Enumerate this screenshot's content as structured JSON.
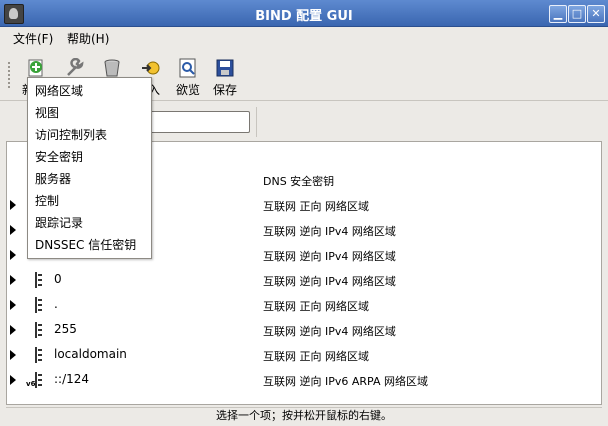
{
  "window": {
    "title": "BIND 配置 GUI",
    "min": "▁",
    "max": "□",
    "close": "✕"
  },
  "menu": {
    "file": "文件(F)",
    "help": "帮助(H)"
  },
  "toolbar": {
    "new_label": "新",
    "import_label": "入",
    "preview_label": "欲览",
    "save_label": "保存",
    "icons": [
      "add-icon",
      "wrench-icon",
      "trash-icon",
      "import-icon",
      "preview-icon",
      "save-icon"
    ]
  },
  "search": {
    "value": ""
  },
  "tree": {
    "rows": [
      {
        "name": "",
        "type": "DNS 安全密钥",
        "icon": false,
        "expander": false
      },
      {
        "name": "",
        "type": "互联网 正向 网络区域",
        "icon": false,
        "expander": true
      },
      {
        "name": "",
        "type": "互联网 逆向 IPv4 网络区域",
        "icon": false,
        "expander": true
      },
      {
        "name": "",
        "type": "互联网 逆向 IPv4 网络区域",
        "icon": false,
        "expander": true
      },
      {
        "name": "0",
        "type": "互联网 逆向 IPv4 网络区域",
        "icon": true,
        "expander": true
      },
      {
        "name": ".",
        "type": "互联网 正向 网络区域",
        "icon": true,
        "expander": true
      },
      {
        "name": "255",
        "type": "互联网 逆向 IPv4 网络区域",
        "icon": true,
        "expander": true
      },
      {
        "name": "localdomain",
        "type": "互联网 正向 网络区域",
        "icon": true,
        "expander": true
      },
      {
        "name": "::/124",
        "type": "互联网 逆向 IPv6 ARPA 网络区域",
        "icon": true,
        "expander": true,
        "badge": "v6"
      }
    ]
  },
  "dropdown": {
    "items": [
      "网络区域",
      "视图",
      "访问控制列表",
      "安全密钥",
      "服务器",
      "控制",
      "跟踪记录",
      "DNSSEC 信任密钥"
    ]
  },
  "status": {
    "text": "选择一个项；按并松开鼠标的右键。"
  }
}
